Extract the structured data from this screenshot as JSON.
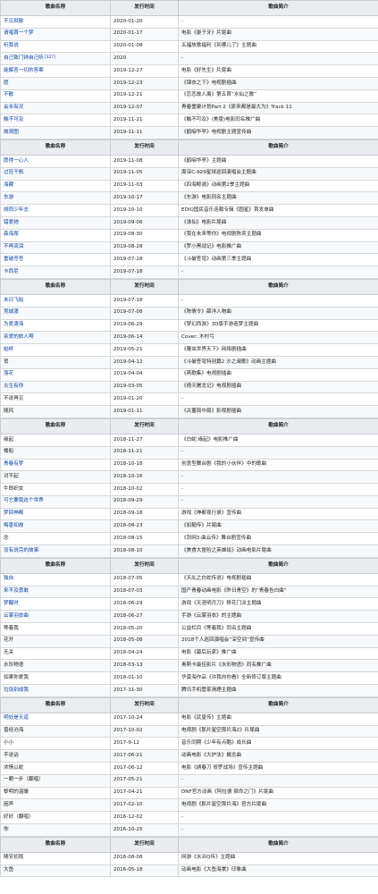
{
  "headers": {
    "name": "歌曲名称",
    "date": "发行时间",
    "desc": "歌曲简介"
  },
  "sections": [
    {
      "rows": [
        {
          "name": "不见就散",
          "link": true,
          "date": "2020-01-20",
          "desc": "-"
        },
        {
          "name": "请唱首一个梦",
          "link": true,
          "date": "2020-01-17",
          "desc": "电影《晏子牙》片尾曲"
        },
        {
          "name": "听我说",
          "link": true,
          "date": "2020-01-08",
          "desc": "五福放歌福利《到哪儿了》主题曲"
        },
        {
          "name": "自己致门钟自己听",
          "link": true,
          "ref": "[327]",
          "date": "2020",
          "desc": "-"
        },
        {
          "name": "能解答一切的答案",
          "link": true,
          "date": "2019-12-27",
          "desc": "电影《好先生》片尾曲"
        },
        {
          "name": "愿",
          "link": true,
          "date": "2019-12-23",
          "desc": "《锦衣之下》电视剧插曲"
        },
        {
          "name": "不散",
          "link": true,
          "date": "2019-12-21",
          "desc": "《恋恋故人离》第五首“水仙之歌”"
        },
        {
          "name": "会永有灵",
          "link": true,
          "date": "2019-12-07",
          "desc": "青春重聚计划Part 2《原来都是最大为》Track 11"
        },
        {
          "name": "触不可及",
          "link": true,
          "date": "2019-11-21",
          "desc": "《触不可及》(美版)电影同名推广曲"
        },
        {
          "name": "故观图",
          "link": true,
          "date": "2019-11-11",
          "desc": "《鹤唳华亭》电视剧主题宣传曲"
        }
      ]
    },
    {
      "rows": [
        {
          "name": "愿得一心人",
          "link": true,
          "date": "2019-11-08",
          "desc": "《鹤唳华亭》主题曲"
        },
        {
          "name": "过狂千帆",
          "link": true,
          "date": "2019-11-05",
          "desc": "周深C-929星球巡回演唱会主题曲"
        },
        {
          "name": "海藏",
          "link": true,
          "date": "2019-11-03",
          "desc": "《四海鲸骑》动画第2季主题曲"
        },
        {
          "name": "东游",
          "link": true,
          "date": "2019-10-17",
          "desc": "《东游》电影同名主题曲"
        },
        {
          "name": "胡同少年志",
          "link": true,
          "date": "2019-10-10",
          "desc": "EDIQ国民音乐连载专辑《圆星》首发单曲"
        },
        {
          "name": "错爱她",
          "link": true,
          "date": "2019-09-06",
          "desc": "《诛仙》电影片尾曲"
        },
        {
          "name": "森海尾",
          "link": true,
          "date": "2019-08-30",
          "desc": "《我在未来等你》电视剧陈奕主题曲"
        },
        {
          "name": "不再流泪",
          "link": true,
          "date": "2019-08-28",
          "desc": "《罗小黑战记》电影推广曲"
        },
        {
          "name": "重破苍苍",
          "link": true,
          "date": "2019-07-28",
          "desc": "《斗破苍穹》动画第三季主题曲"
        },
        {
          "name": "卡西尼",
          "link": true,
          "date": "2019-07-18",
          "desc": "-"
        }
      ]
    },
    {
      "rows": [
        {
          "name": "末日飞船",
          "link": true,
          "date": "2019-07-18",
          "desc": "-"
        },
        {
          "name": "竞城渡",
          "link": true,
          "date": "2019-07-08",
          "desc": "《陈情令》薛洋人物曲"
        },
        {
          "name": "为爱渡海",
          "link": true,
          "date": "2019-06-29",
          "desc": "《梦幻西游》3D版手游造梦主题曲"
        },
        {
          "name": "亲爱的旅人啊",
          "link": true,
          "date": "2019-06-14",
          "desc": "Cover: 木村弓"
        },
        {
          "name": "始终",
          "link": true,
          "date": "2019-05-21",
          "desc": "《覆虫世界天下》网络剧插曲"
        },
        {
          "name": "贺",
          "link": false,
          "date": "2019-04-12",
          "desc": "《斗破苍穹特别篇2 沙之澜歌》动画主题曲"
        },
        {
          "name": "落花",
          "link": true,
          "date": "2019-04-04",
          "desc": "《燕歌集》电视剧插曲"
        },
        {
          "name": "炎生有你",
          "link": true,
          "date": "2019-03-05",
          "desc": "《倚天屠龙记》电视剧插曲"
        },
        {
          "name": "不说再见",
          "link": false,
          "date": "2019-01-20",
          "desc": "-"
        },
        {
          "name": "随风",
          "link": false,
          "date": "2019-01-11",
          "desc": "《古董局中局》影视剧插曲"
        }
      ]
    },
    {
      "rows": [
        {
          "name": "缘起",
          "link": false,
          "date": "2018-11-27",
          "desc": "《白蛇:缘起》电影推广曲"
        },
        {
          "name": "楼船",
          "link": false,
          "date": "2018-11-21",
          "desc": "-"
        },
        {
          "name": "青春有梦",
          "link": true,
          "date": "2018-10-18",
          "desc": "创意型舞台剧《我的小伙伴》中的歌曲"
        },
        {
          "name": "对不起",
          "link": false,
          "date": "2018-10-16",
          "desc": "-"
        },
        {
          "name": "牛郎织女",
          "link": false,
          "date": "2018-10-02",
          "desc": "-"
        },
        {
          "name": "可它要我这个世界",
          "link": true,
          "date": "2018-09-29",
          "desc": "-"
        },
        {
          "name": "梦回神都",
          "link": true,
          "date": "2018-09-18",
          "desc": "游戏《神都夜行录》宣传曲"
        },
        {
          "name": "梅香如故",
          "link": true,
          "date": "2018-08-23",
          "desc": "《如懿传》片尾曲"
        },
        {
          "name": "念",
          "link": false,
          "date": "2018-08-15",
          "desc": "《剑网3·曲云传》舞台剧宣传曲"
        },
        {
          "name": "没有说完的故事",
          "link": true,
          "date": "2018-08-10",
          "desc": "《美食大冒险之英雄烩》动画电影片尾曲"
        }
      ]
    },
    {
      "rows": [
        {
          "name": "独自",
          "link": true,
          "date": "2018-07-05",
          "desc": "《天乩之白蛇传说》电视剧插曲"
        },
        {
          "name": "来不及勇敢",
          "link": true,
          "date": "2018-07-03",
          "desc": "国产青春动画电影《昨日青空》的“青春告白曲”"
        },
        {
          "name": "梦醒时",
          "link": true,
          "date": "2018-06-29",
          "desc": "游戏《天涯明月刀》移花门派主题曲"
        },
        {
          "name": "云裳羽衣曲",
          "link": true,
          "date": "2018-06-27",
          "desc": "手游《云裳羽衣》的主题曲"
        },
        {
          "name": "等着我",
          "link": false,
          "date": "2018-05-20",
          "desc": "公益栏目《等着我》同名主题曲"
        },
        {
          "name": "花开",
          "link": false,
          "date": "2018-05-08",
          "desc": "2018个人巡回演唱会“深空间”宣传曲"
        },
        {
          "name": "无关",
          "link": false,
          "date": "2018-04-24",
          "desc": "电影《幕后玩家》推广曲"
        },
        {
          "name": "水形物语",
          "link": false,
          "date": "2018-03-13",
          "desc": "奥斯卡最佳影片《水形物语》同名推广曲"
        },
        {
          "name": "如果你爱我",
          "link": false,
          "date": "2018-01-10",
          "desc": "华莫海作品《许我向你看》全新修订版主题曲"
        },
        {
          "name": "垃圾别成我",
          "link": true,
          "date": "2017-11-30",
          "desc": "腾讯手机管家清理主题曲"
        }
      ]
    },
    {
      "rows": [
        {
          "name": "明处是天道",
          "link": true,
          "date": "2017-10-24",
          "desc": "电影《武皇传》主题曲"
        },
        {
          "name": "曾经沧海",
          "link": false,
          "date": "2017-10-02",
          "desc": "电视剧《那片星空那片海2》片尾曲"
        },
        {
          "name": "小小",
          "link": false,
          "date": "2017-9-12",
          "desc": "音乐同期《少年有点酷》成长曲"
        },
        {
          "name": "不说话",
          "link": false,
          "date": "2017-06-21",
          "desc": "动画电影《大护法》概念曲"
        },
        {
          "name": "浓情以蛇",
          "link": false,
          "date": "2017-06-12",
          "desc": "电影《绣春刀 修罗战场》宣传主题曲"
        },
        {
          "name": "一颗一步（翻唱）",
          "link": false,
          "date": "2017-05-21",
          "desc": "-"
        },
        {
          "name": "黎明的温暖",
          "link": false,
          "date": "2017-04-21",
          "desc": "DNF官方动画《阿拉德 宿命之门》片尾曲"
        },
        {
          "name": "困声",
          "link": false,
          "date": "2017-02-10",
          "desc": "电视剧《那片星空那片海》官方片尾曲"
        },
        {
          "name": "好好（翻唱）",
          "link": false,
          "date": "2016-12-02",
          "desc": "-"
        },
        {
          "name": "你",
          "link": false,
          "date": "2016-10-25",
          "desc": "-"
        }
      ]
    },
    {
      "rows": [
        {
          "name": "随安初雨",
          "link": false,
          "date": "2016-08-08",
          "desc": "网游《水浒Q传》主题曲"
        },
        {
          "name": "大鱼",
          "link": false,
          "date": "2016-05-18",
          "desc": "动画电影《大鱼海棠》印象曲"
        }
      ]
    }
  ]
}
